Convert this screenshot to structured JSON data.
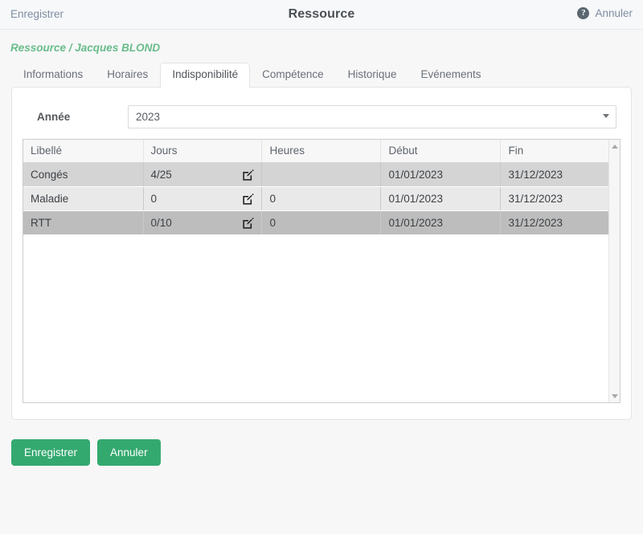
{
  "topbar": {
    "save_link": "Enregistrer",
    "title": "Ressource",
    "help_icon": "help-circle-icon",
    "help_glyph": "?",
    "cancel_link": "Annuler"
  },
  "breadcrumb": "Ressource / Jacques BLOND",
  "tabs": [
    {
      "label": "Informations",
      "active": false
    },
    {
      "label": "Horaires",
      "active": false
    },
    {
      "label": "Indisponibilité",
      "active": true
    },
    {
      "label": "Compétence",
      "active": false
    },
    {
      "label": "Historique",
      "active": false
    },
    {
      "label": "Evénements",
      "active": false
    }
  ],
  "form": {
    "year_label": "Année",
    "year_value": "2023",
    "year_options": [
      "2023"
    ],
    "year_dropdown_icon": "chevron-down-icon"
  },
  "table": {
    "columns": [
      "Libellé",
      "Jours",
      "Heures",
      "Début",
      "Fin"
    ],
    "row_edit_icon": "edit-pencil-square-icon",
    "rows": [
      {
        "libelle": "Congés",
        "jours": "4/25",
        "heures": "",
        "debut": "01/01/2023",
        "fin": "31/12/2023",
        "state": "odd"
      },
      {
        "libelle": "Maladie",
        "jours": "0",
        "heures": "0",
        "debut": "01/01/2023",
        "fin": "31/12/2023",
        "state": "even"
      },
      {
        "libelle": "RTT",
        "jours": "0/10",
        "heures": "0",
        "debut": "01/01/2023",
        "fin": "31/12/2023",
        "state": "sel"
      }
    ],
    "scroll_up_icon": "scroll-up-arrow-icon",
    "scroll_down_icon": "scroll-down-arrow-icon"
  },
  "footer": {
    "save_label": "Enregistrer",
    "cancel_label": "Annuler"
  },
  "colors": {
    "accent_green": "#34a96f",
    "breadcrumb_green": "#69bd8a",
    "link_blue_gray": "#7e8da0",
    "row_odd": "#d4d4d4",
    "row_even": "#e9e9e9",
    "row_selected": "#bdbdbd",
    "page_background": "#f7f7f8"
  }
}
